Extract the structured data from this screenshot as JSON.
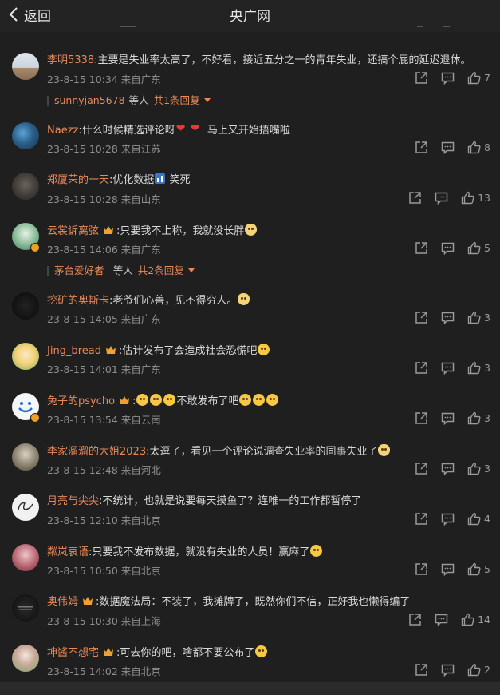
{
  "header": {
    "back_label": "返回",
    "title": "央广网"
  },
  "comments": [
    {
      "name": "李明5338",
      "pre": "",
      "text": ":主要是失业率太高了，不好看，接近五分之一的青年失业，还搞个屁的延迟退休。",
      "tail": "",
      "time": "23-8-15 10:34",
      "loc": "来自广东",
      "likes": "7"
    },
    {
      "name": "Naezz",
      "pre": "",
      "text": ":什么时候精选评论呀",
      "tail": " 马上又开始捂嘴啦",
      "time": "23-8-15 10:28",
      "loc": "来自江苏",
      "likes": "8"
    },
    {
      "name": "郑厦荣的一天",
      "pre": "",
      "text": ":优化数据",
      "tail": " 笑死",
      "time": "23-8-15 10:28",
      "loc": "来自山东",
      "likes": "13"
    },
    {
      "name": "云裳诉离弦",
      "pre": "",
      "text": ":只要我不上称，我就没长胖",
      "tail": "",
      "time": "23-8-15 14:06",
      "loc": "来自广东",
      "likes": "5"
    },
    {
      "name": "挖矿的奥斯卡",
      "pre": "",
      "text": ":老爷们心善，见不得穷人。",
      "tail": "",
      "time": "23-8-15 14:05",
      "loc": "来自广东",
      "likes": "3"
    },
    {
      "name": "Jing_bread",
      "pre": "",
      "text": ":估计发布了会造成社会恐慌吧",
      "tail": "",
      "time": "23-8-15 14:01",
      "loc": "来自广东",
      "likes": "3"
    },
    {
      "name": "兔子的psycho",
      "pre": "",
      "text": ":",
      "tail": "不敢发布了吧",
      "time": "23-8-15 13:54",
      "loc": "来自云南",
      "likes": "3"
    },
    {
      "name": "李家溜溜的大姐2023",
      "pre": "",
      "text": ":太逗了，看见一个评论说调查失业率的同事失业了",
      "tail": "",
      "time": "23-8-15 12:48",
      "loc": "来自河北",
      "likes": "3"
    },
    {
      "name": "月亮与尖尖",
      "pre": "",
      "text": ":不统计，也就是说要每天摸鱼了？连唯一的工作都暂停了",
      "tail": "",
      "time": "23-8-15 12:10",
      "loc": "来自北京",
      "likes": "4"
    },
    {
      "name": "粼岚哀语",
      "pre": "",
      "text": ":只要我不发布数据，就没有失业的人员！赢麻了",
      "tail": "",
      "time": "23-8-15 10:50",
      "loc": "来自北京",
      "likes": "5"
    },
    {
      "name": "奥伟姆",
      "pre": "",
      "text": ":数据魔法局：不装了，我摊牌了，既然你们不信，正好我也懒得编了",
      "tail": "",
      "time": "23-8-15 10:30",
      "loc": "来自上海",
      "likes": "14"
    },
    {
      "name": "坤酱不想宅",
      "pre": "",
      "text": ":可去你的吧，啥都不要公布了",
      "tail": "",
      "time": "23-8-15 14:02",
      "loc": "来自北京",
      "likes": "2"
    }
  ],
  "replies": [
    {
      "user": "sunnyjan5678",
      "mid": "等人",
      "count": "共1条回复"
    },
    {
      "user": "茅台爱好者_",
      "mid": "等人",
      "count": "共2条回复"
    }
  ],
  "colors": {
    "background": "#1f1f1f",
    "username": "#e8895a",
    "meta": "#8e8e8e",
    "text": "#d8d8d8"
  }
}
